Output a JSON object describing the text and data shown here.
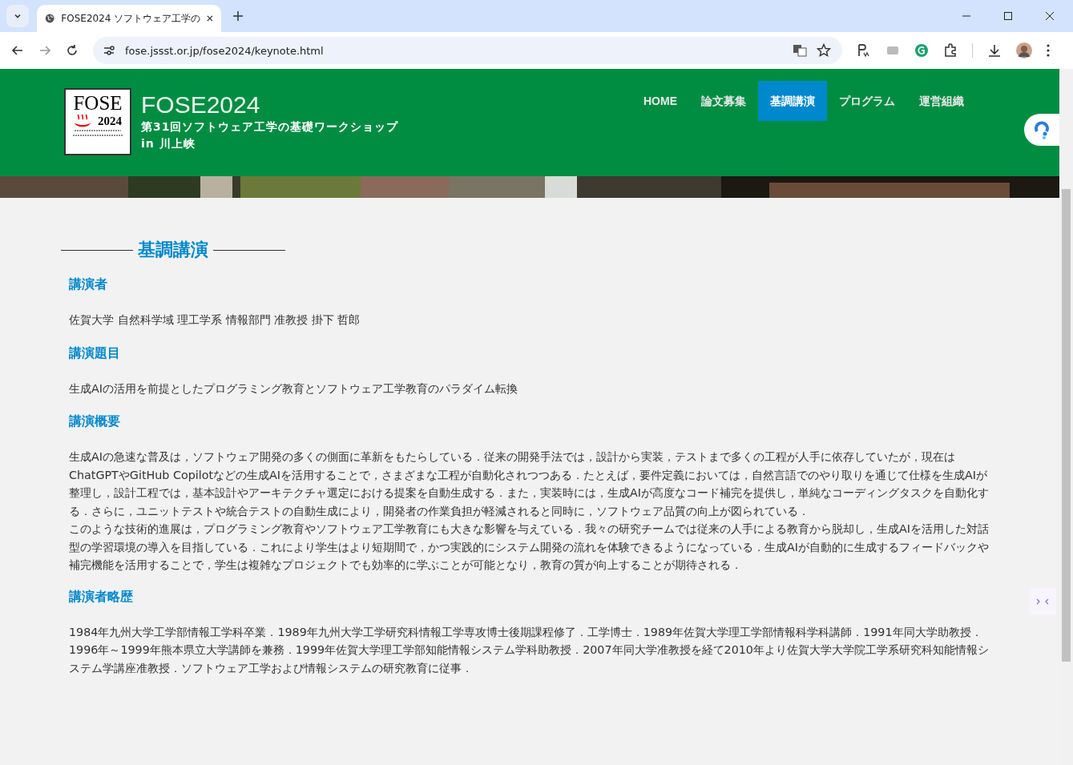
{
  "browser": {
    "tab_title": "FOSE2024 ソフトウェア工学の",
    "url": "fose.jssst.or.jp/fose2024/keynote.html"
  },
  "header": {
    "logo": {
      "title": "FOSE",
      "year": "2024"
    },
    "title": "FOSE2024",
    "subtitle": "第31回ソフトウェア工学の基礎ワークショップ",
    "location": "in 川上峡",
    "nav": [
      {
        "label": "HOME",
        "selected": false
      },
      {
        "label": "論文募集",
        "selected": false
      },
      {
        "label": "基調講演",
        "selected": true
      },
      {
        "label": "プログラム",
        "selected": false
      },
      {
        "label": "運営組織",
        "selected": false
      }
    ]
  },
  "page_heading": "基調講演",
  "sections": [
    {
      "heading": "講演者",
      "paragraphs": [
        "佐賀大学 自然科学域 理工学系 情報部門 准教授 掛下 哲郎"
      ]
    },
    {
      "heading": "講演題目",
      "paragraphs": [
        "生成AIの活用を前提としたプログラミング教育とソフトウェア工学教育のパラダイム転換"
      ]
    },
    {
      "heading": "講演概要",
      "paragraphs": [
        "生成AIの急速な普及は，ソフトウェア開発の多くの側面に革新をもたらしている．従来の開発手法では，設計から実装，テストまで多くの工程が人手に依存していたが，現在はChatGPTやGitHub Copilotなどの生成AIを活用することで，さまざまな工程が自動化されつつある．たとえば，要件定義においては，自然言語でのやり取りを通じて仕様を生成AIが整理し，設計工程では，基本設計やアーキテクチャ選定における提案を自動生成する．また，実装時には，生成AIが高度なコード補完を提供し，単純なコーディングタスクを自動化する．さらに，ユニットテストや統合テストの自動生成により，開発者の作業負担が軽減されると同時に，ソフトウェア品質の向上が図られている．",
        "このような技術的進展は，プログラミング教育やソフトウェア工学教育にも大きな影響を与えている．我々の研究チームでは従来の人手による教育から脱却し，生成AIを活用した対話型の学習環境の導入を目指している．これにより学生はより短期間で，かつ実践的にシステム開発の流れを体験できるようになっている．生成AIが自動的に生成するフィードバックや補完機能を活用することで，学生は複雑なプロジェクトでも効率的に学ぶことが可能となり，教育の質が向上することが期待される．"
      ]
    },
    {
      "heading": "講演者略歴",
      "paragraphs": [
        "1984年九州大学工学部情報工学科卒業．1989年九州大学工学研究科情報工学専攻博士後期課程修了．工学博士．1989年佐賀大学理工学部情報科学科講師．1991年同大学助教授．1996年～1999年熊本県立大学講師を兼務．1999年佐賀大学理工学部知能情報システム学科助教授．2007年同大学准教授を経て2010年より佐賀大学大学院工学系研究科知能情報システム学講座准教授．ソフトウェア工学および情報システムの研究教育に従事．"
      ]
    }
  ]
}
